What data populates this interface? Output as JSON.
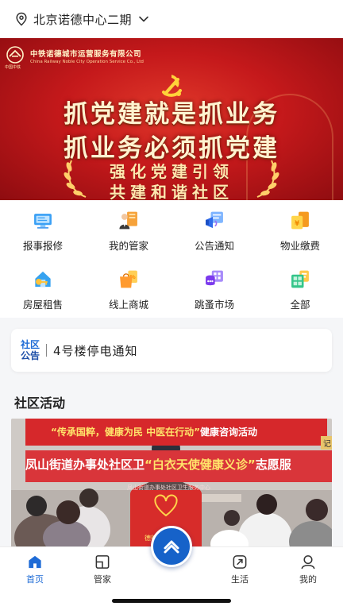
{
  "location": {
    "name": "北京诺德中心二期"
  },
  "banner": {
    "company_cn": "中铁诺德城市运营服务有限公司",
    "company_en": "China Railway Noble City Operation Service Co., Ltd",
    "logo_caption": "中国中铁",
    "slogan_1": "抓党建就是抓业务",
    "slogan_2": "抓业务必须抓党建",
    "slogan_3": "强化党建引领",
    "slogan_4": "共建和谐社区"
  },
  "menu": {
    "items": [
      {
        "label": "报事报修",
        "icon": "report-repair-icon"
      },
      {
        "label": "我的管家",
        "icon": "butler-icon"
      },
      {
        "label": "公告通知",
        "icon": "announcement-icon"
      },
      {
        "label": "物业缴费",
        "icon": "property-fee-icon"
      },
      {
        "label": "房屋租售",
        "icon": "house-rental-icon"
      },
      {
        "label": "线上商城",
        "icon": "online-mall-icon"
      },
      {
        "label": "跳蚤市场",
        "icon": "flea-market-icon"
      },
      {
        "label": "全部",
        "icon": "all-services-icon"
      }
    ]
  },
  "notice": {
    "tag_line1": "社区",
    "tag_line2": "公告",
    "text": "4号楼停电通知"
  },
  "section": {
    "title": "社区活动"
  },
  "activity": {
    "banner_line1_a": "“传承国粹，健康为民 中医在行动”",
    "banner_line1_b": "健康咨询活动",
    "banner_line2_a": "凤山街道办事处社区卫",
    "banner_line2_b": "“白衣天使健康义诊”",
    "banner_line2_c": "志愿服",
    "banner_small": "凤山街道办事处社区卫生服务中心",
    "vest_text": "德德加油",
    "right_tag": "记"
  },
  "tabbar": {
    "tabs": [
      {
        "label": "首页",
        "icon": "home-icon",
        "active": true
      },
      {
        "label": "管家",
        "icon": "butler-tab-icon",
        "active": false
      },
      {
        "label": "生活",
        "icon": "life-icon",
        "active": false
      },
      {
        "label": "我的",
        "icon": "profile-icon",
        "active": false
      }
    ]
  },
  "colors": {
    "accent": "#1e6bd6",
    "banner_red": "#c5191b",
    "fab": "#1662c9"
  }
}
